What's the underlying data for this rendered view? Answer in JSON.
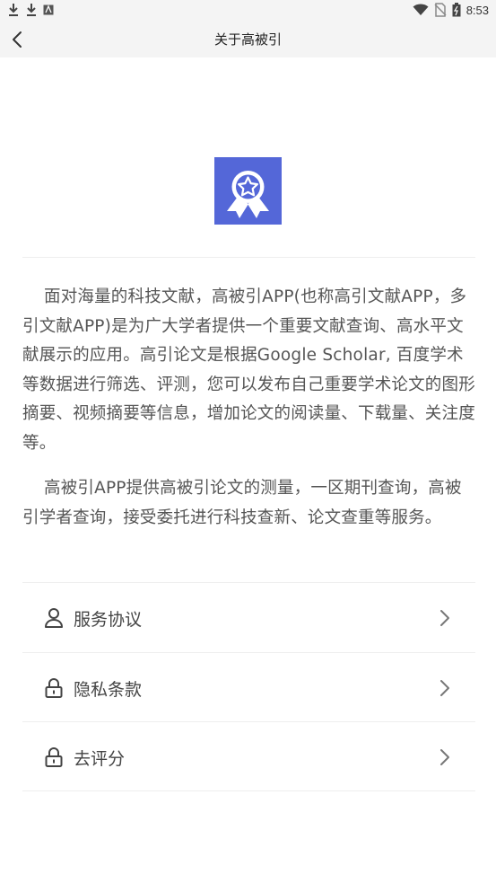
{
  "status_bar": {
    "time": "8:53",
    "left_icons": [
      "download-icon",
      "download-icon",
      "app-notification-icon"
    ],
    "right_icons": [
      "wifi-icon",
      "no-sim-icon",
      "battery-icon"
    ]
  },
  "nav": {
    "back_icon": "chevron-left-icon",
    "title": "关于高被引"
  },
  "logo": {
    "icon": "award-ribbon-star-icon",
    "color": "#5467d8"
  },
  "about": {
    "paragraphs": [
      "面对海量的科技文献，高被引APP(也称高引文献APP，多引文献APP)是为广大学者提供一个重要文献查询、高水平文献展示的应用。高引论文是根据Google Scholar, 百度学术等数据进行筛选、评测，您可以发布自己重要学术论文的图形摘要、视频摘要等信息，增加论文的阅读量、下载量、关注度等。",
      "高被引APP提供高被引论文的测量，一区期刊查询，高被引学者查询，接受委托进行科技查新、论文查重等服务。"
    ]
  },
  "menu": {
    "items": [
      {
        "label": "服务协议",
        "icon": "user-icon"
      },
      {
        "label": "隐私条款",
        "icon": "lock-icon"
      },
      {
        "label": "去评分",
        "icon": "lock-icon"
      }
    ],
    "chevron_icon": "chevron-right-icon"
  }
}
